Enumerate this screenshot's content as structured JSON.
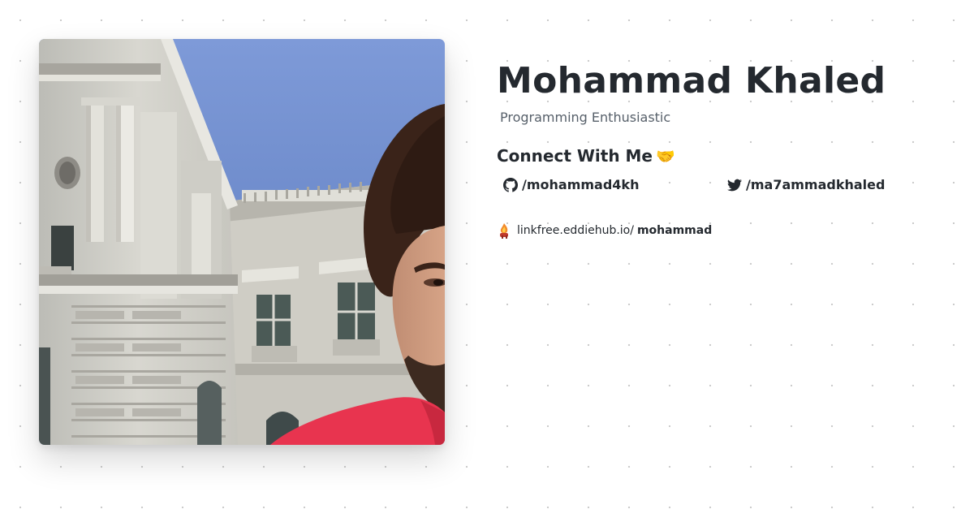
{
  "profile": {
    "name": "Mohammad Khaled",
    "tagline": "Programming Enthusiastic",
    "photo_icon": "profile-photo"
  },
  "connect": {
    "heading": "Connect With Me",
    "emoji": "🤝"
  },
  "socials": [
    {
      "icon": "github-icon",
      "handle": "/mohammad4kh"
    },
    {
      "icon": "twitter-icon",
      "handle": "/ma7ammadkhaled"
    }
  ],
  "linkfree": {
    "icon": "linkfree-logo-icon",
    "domain": "linkfree.eddiehub.io/",
    "username": "mohammad"
  },
  "colors": {
    "text": "#24292f",
    "muted": "#57606a",
    "sky": "#6f8fd0",
    "shirt": "#e8344f"
  }
}
